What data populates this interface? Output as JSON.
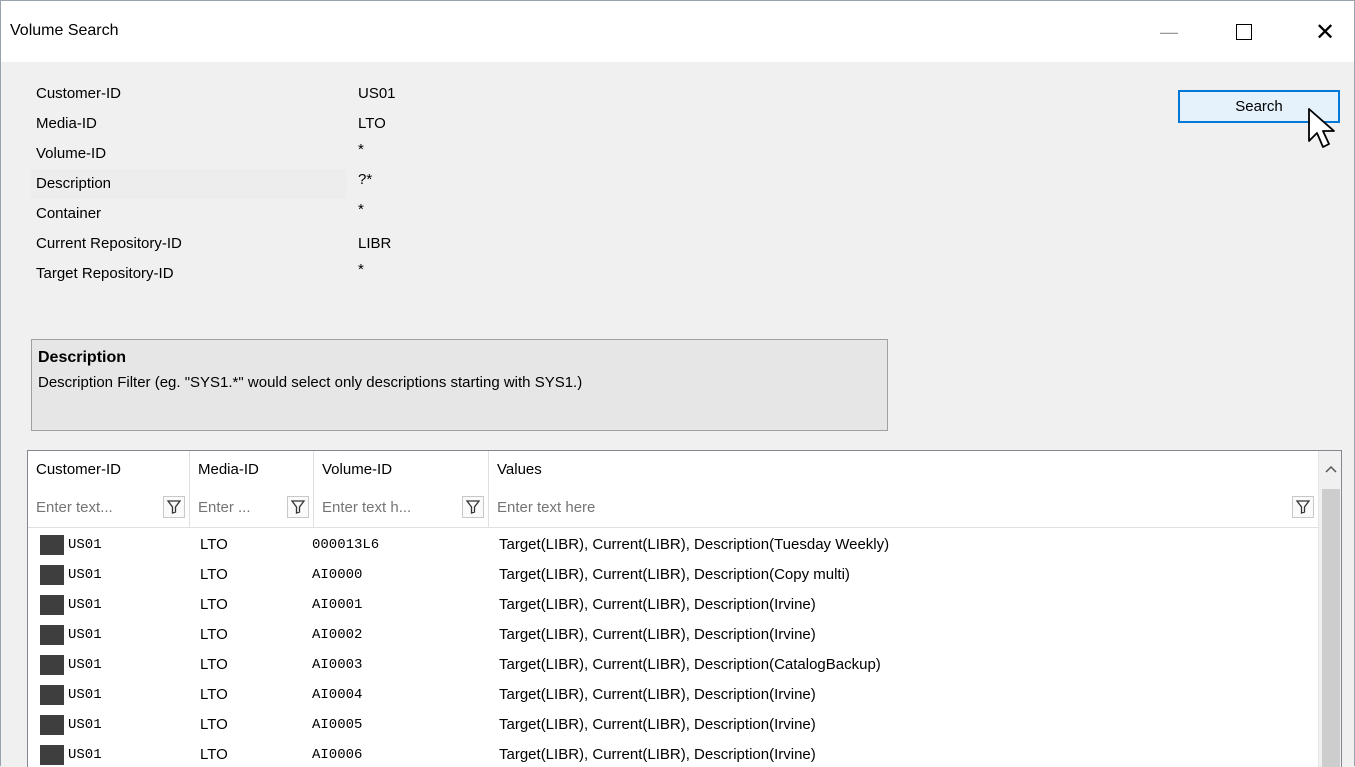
{
  "window": {
    "title": "Volume Search",
    "minimize": "—",
    "close": "✕"
  },
  "properties": [
    {
      "name": "Customer-ID",
      "value": "US01"
    },
    {
      "name": "Media-ID",
      "value": "LTO"
    },
    {
      "name": "Volume-ID",
      "value": "*"
    },
    {
      "name": "Description",
      "value": "?*"
    },
    {
      "name": "Container",
      "value": "*"
    },
    {
      "name": "Current Repository-ID",
      "value": "LIBR"
    },
    {
      "name": "Target Repository-ID",
      "value": "*"
    }
  ],
  "description_panel": {
    "title": "Description",
    "text": "Description Filter (eg. \"SYS1.*\" would select only descriptions starting with SYS1.)"
  },
  "search_button": {
    "label": "Search"
  },
  "table": {
    "columns": [
      "Customer-ID",
      "Media-ID",
      "Volume-ID",
      "Values"
    ],
    "filters": [
      "Enter text...",
      "Enter ...",
      "Enter text h...",
      "Enter text here"
    ],
    "rows": [
      {
        "customer": "US01",
        "media": "LTO",
        "volume": "000013L6",
        "values": "Target(LIBR), Current(LIBR), Description(Tuesday Weekly)"
      },
      {
        "customer": "US01",
        "media": "LTO",
        "volume": "AI0000",
        "values": "Target(LIBR), Current(LIBR), Description(Copy multi)"
      },
      {
        "customer": "US01",
        "media": "LTO",
        "volume": "AI0001",
        "values": "Target(LIBR), Current(LIBR), Description(Irvine)"
      },
      {
        "customer": "US01",
        "media": "LTO",
        "volume": "AI0002",
        "values": "Target(LIBR), Current(LIBR), Description(Irvine)"
      },
      {
        "customer": "US01",
        "media": "LTO",
        "volume": "AI0003",
        "values": "Target(LIBR), Current(LIBR), Description(CatalogBackup)"
      },
      {
        "customer": "US01",
        "media": "LTO",
        "volume": "AI0004",
        "values": "Target(LIBR), Current(LIBR), Description(Irvine)"
      },
      {
        "customer": "US01",
        "media": "LTO",
        "volume": "AI0005",
        "values": "Target(LIBR), Current(LIBR), Description(Irvine)"
      },
      {
        "customer": "US01",
        "media": "LTO",
        "volume": "AI0006",
        "values": "Target(LIBR), Current(LIBR), Description(Irvine)"
      }
    ]
  },
  "icons": {
    "row_icon": "tape-icon",
    "filter_icon": "funnel-icon",
    "cursor": "mouse-pointer-icon"
  }
}
